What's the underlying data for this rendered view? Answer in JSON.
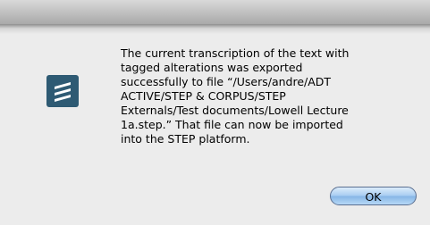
{
  "dialog": {
    "message": "The current transcription of the text with\ntagged alterations was exported\nsuccessfully to file “/Users/andre/ADT\nACTIVE/STEP & CORPUS/STEP\nExternals/Test documents/Lowell Lecture\n1a.step.” That file can now be imported\ninto the STEP platform.",
    "ok_label": "OK",
    "app_icon": "step-app-icon"
  },
  "colors": {
    "icon_background": "#2e5a73",
    "button_accent": "#86b6e6",
    "panel_background": "#ececec"
  }
}
